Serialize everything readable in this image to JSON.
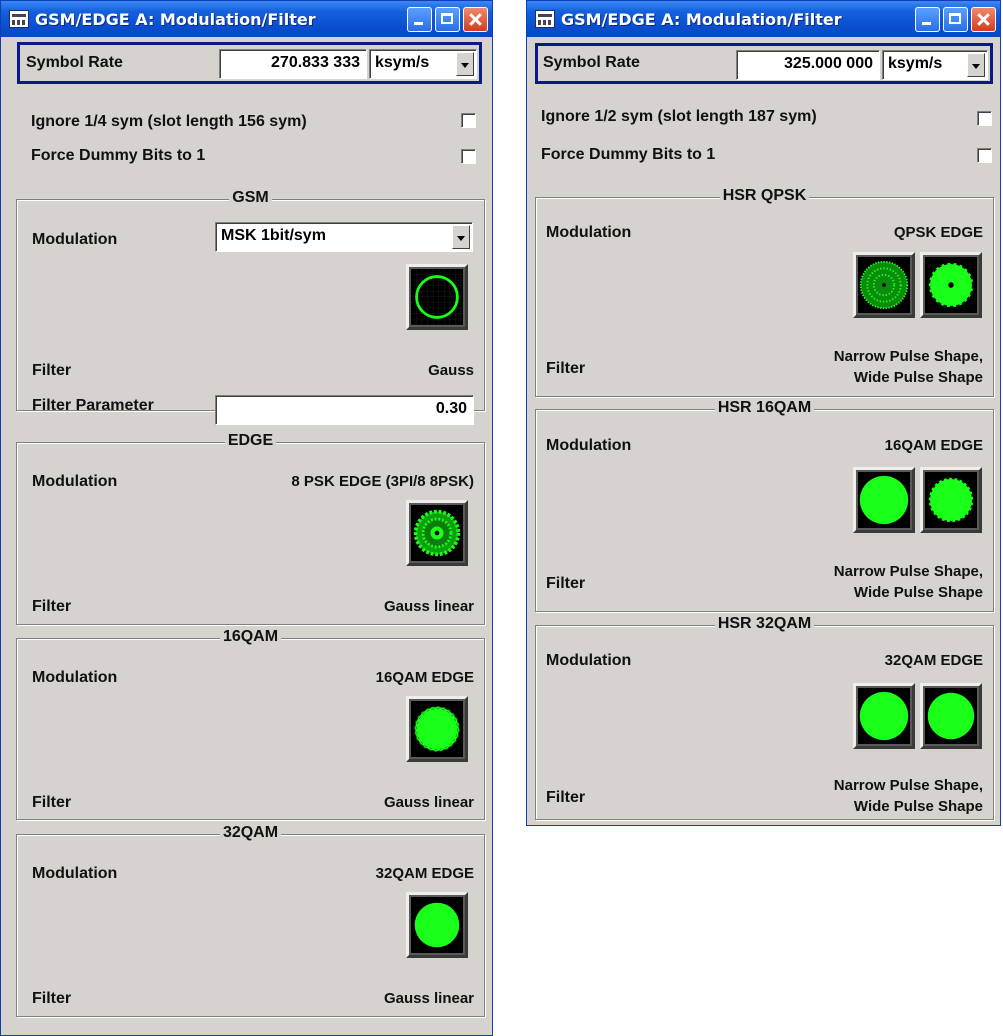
{
  "colors": {
    "constellation": "#19ff19",
    "titlebar": "#0a4fd0",
    "panel": "#d6d3ce",
    "highlight_border": "#0a1a8a"
  },
  "left": {
    "title": "GSM/EDGE A: Modulation/Filter",
    "symbol_rate": {
      "label": "Symbol Rate",
      "value": "270.833 333",
      "unit": "ksym/s"
    },
    "ignore_label": "Ignore 1/4 sym (slot length 156 sym)",
    "force_label": "Force Dummy Bits to 1",
    "groups": [
      {
        "title": "GSM",
        "modulation_label": "Modulation",
        "modulation_value": "MSK 1bit/sym",
        "constellation": "ring-icon",
        "filter_label": "Filter",
        "filter_value": "Gauss",
        "filter_param_label": "Filter Parameter",
        "filter_param_value": "0.30"
      },
      {
        "title": "EDGE",
        "modulation_label": "Modulation",
        "modulation_value": "8 PSK EDGE (3PI/8 8PSK)",
        "constellation": "8psk-icon",
        "filter_label": "Filter",
        "filter_value": "Gauss linear"
      },
      {
        "title": "16QAM",
        "modulation_label": "Modulation",
        "modulation_value": "16QAM EDGE",
        "constellation": "16qam-icon",
        "filter_label": "Filter",
        "filter_value": "Gauss linear"
      },
      {
        "title": "32QAM",
        "modulation_label": "Modulation",
        "modulation_value": "32QAM EDGE",
        "constellation": "32qam-icon",
        "filter_label": "Filter",
        "filter_value": "Gauss linear"
      }
    ]
  },
  "right": {
    "title": "GSM/EDGE A: Modulation/Filter",
    "symbol_rate": {
      "label": "Symbol Rate",
      "value": "325.000 000",
      "unit": "ksym/s"
    },
    "ignore_label": "Ignore 1/2 sym (slot length 187 sym)",
    "force_label": "Force Dummy Bits to 1",
    "groups": [
      {
        "title": "HSR QPSK",
        "modulation_label": "Modulation",
        "modulation_value": "QPSK EDGE",
        "filter_label": "Filter",
        "filter_value_1": "Narrow Pulse Shape,",
        "filter_value_2": "Wide Pulse Shape"
      },
      {
        "title": "HSR 16QAM",
        "modulation_label": "Modulation",
        "modulation_value": "16QAM EDGE",
        "filter_label": "Filter",
        "filter_value_1": "Narrow Pulse Shape,",
        "filter_value_2": "Wide Pulse Shape"
      },
      {
        "title": "HSR 32QAM",
        "modulation_label": "Modulation",
        "modulation_value": "32QAM EDGE",
        "filter_label": "Filter",
        "filter_value_1": "Narrow Pulse Shape,",
        "filter_value_2": "Wide Pulse Shape"
      }
    ]
  }
}
